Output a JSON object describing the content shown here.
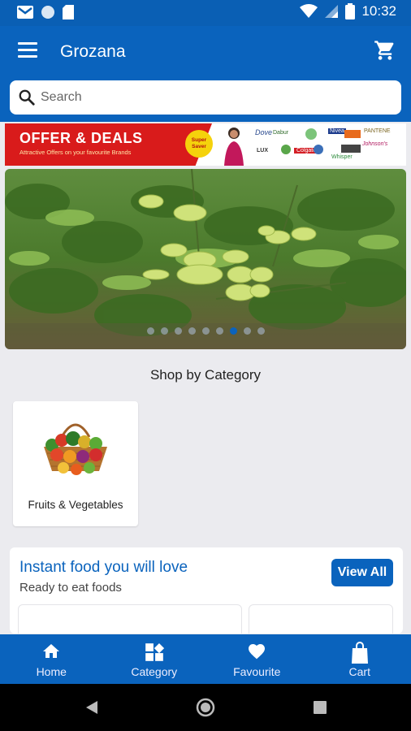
{
  "status_bar": {
    "time": "10:32",
    "icons": [
      "gmail-icon",
      "circle-icon",
      "sd-card-icon",
      "wifi-icon",
      "signal-icon",
      "battery-icon"
    ]
  },
  "app_bar": {
    "title": "Grozana",
    "menu_icon": "menu-icon",
    "cart_icon": "cart-icon"
  },
  "search": {
    "placeholder": "Search"
  },
  "offer_banner": {
    "title": "OFFER & DEALS",
    "subtitle": "Attractive Offers on your favourite Brands",
    "seal": "Super Saver",
    "brands": [
      "Dove",
      "Dabur",
      "Colgate",
      "LUX",
      "Johnson's",
      "PANTENE",
      "Nivea",
      "Whisper"
    ]
  },
  "carousel": {
    "slide_count": 9,
    "active_index": 6
  },
  "shop_by_category": {
    "title": "Shop by Category",
    "categories": [
      {
        "label": "Fruits & Vegetables",
        "icon": "fruit-basket-icon"
      }
    ]
  },
  "instant_food": {
    "title": "Instant food you will love",
    "subtitle": "Ready to eat foods",
    "view_all": "View All"
  },
  "bottom_nav": {
    "items": [
      {
        "label": "Home",
        "icon": "home-icon"
      },
      {
        "label": "Category",
        "icon": "category-icon"
      },
      {
        "label": "Favourite",
        "icon": "heart-icon"
      },
      {
        "label": "Cart",
        "icon": "bag-icon"
      }
    ]
  },
  "system_nav": {
    "buttons": [
      "back-icon",
      "home-circle-icon",
      "recents-icon"
    ]
  },
  "colors": {
    "primary": "#0a63bd",
    "offer_red": "#d91b1b",
    "background": "#ebebef"
  }
}
